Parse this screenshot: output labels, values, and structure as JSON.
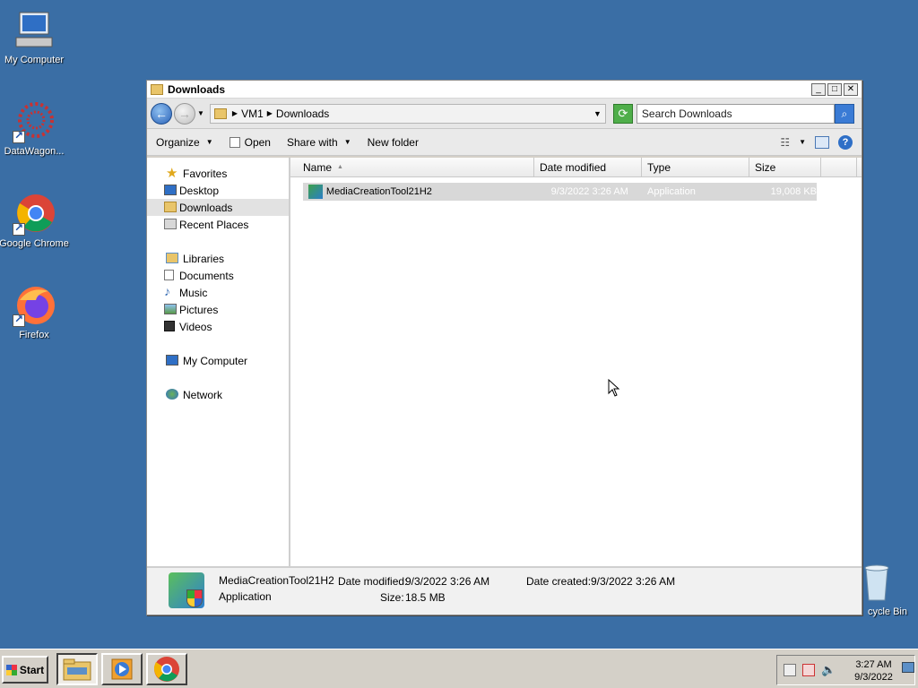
{
  "desktop": {
    "icons": [
      {
        "label": "My Computer"
      },
      {
        "label": "DataWagon..."
      },
      {
        "label": "Google Chrome"
      },
      {
        "label": "Firefox"
      },
      {
        "label": "cycle Bin"
      }
    ]
  },
  "window": {
    "title": "Downloads",
    "address": {
      "crumbs": [
        "VM1",
        "Downloads"
      ]
    },
    "search_placeholder": "Search Downloads",
    "toolbar": {
      "organize": "Organize",
      "open": "Open",
      "share_with": "Share with",
      "new_folder": "New folder"
    },
    "nav": {
      "favorites": "Favorites",
      "desktop": "Desktop",
      "downloads": "Downloads",
      "recent_places": "Recent Places",
      "libraries": "Libraries",
      "documents": "Documents",
      "music": "Music",
      "pictures": "Pictures",
      "videos": "Videos",
      "my_computer": "My Computer",
      "network": "Network"
    },
    "columns": {
      "name": "Name",
      "date_modified": "Date modified",
      "type": "Type",
      "size": "Size"
    },
    "files": [
      {
        "name": "MediaCreationTool21H2",
        "date_modified": "9/3/2022 3:26 AM",
        "type": "Application",
        "size": "19,008 KB"
      }
    ],
    "details": {
      "name": "MediaCreationTool21H2",
      "type": "Application",
      "date_modified_label": "Date modified:",
      "date_modified": "9/3/2022 3:26 AM",
      "size_label": "Size:",
      "size": "18.5 MB",
      "date_created_label": "Date created:",
      "date_created": "9/3/2022 3:26 AM"
    }
  },
  "taskbar": {
    "start": "Start",
    "clock_time": "3:27 AM",
    "clock_date": "9/3/2022"
  }
}
